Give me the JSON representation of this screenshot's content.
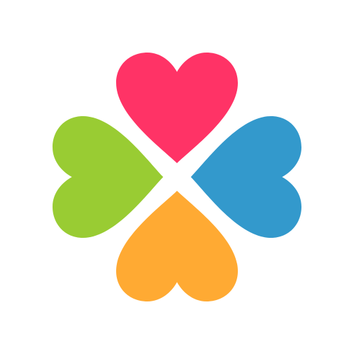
{
  "logo": {
    "background": "#ffffff",
    "hearts": [
      {
        "name": "top",
        "color": "#FF3366"
      },
      {
        "name": "right",
        "color": "#3399CC"
      },
      {
        "name": "bottom",
        "color": "#FFAA33"
      },
      {
        "name": "left",
        "color": "#99CC33"
      }
    ]
  }
}
